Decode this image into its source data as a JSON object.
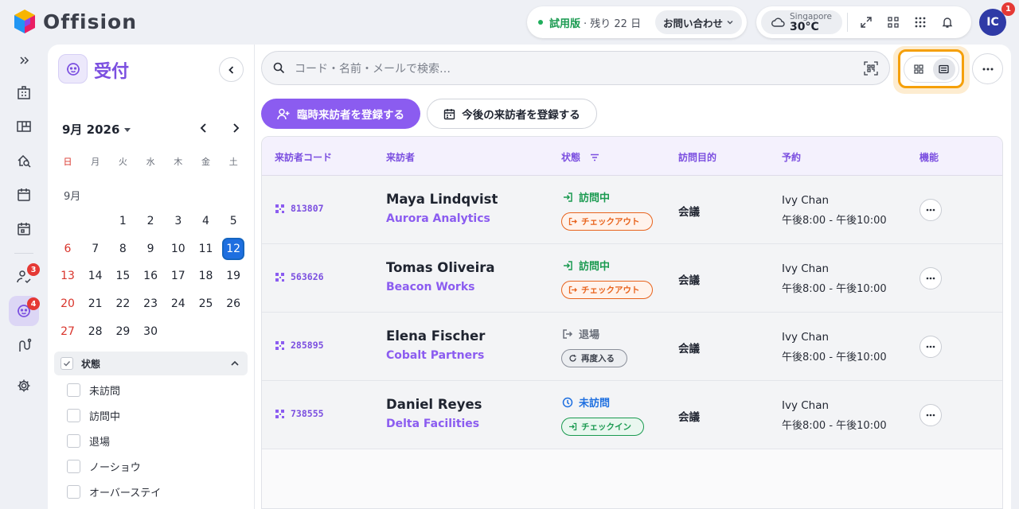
{
  "app": {
    "name": "Offision"
  },
  "trial": {
    "label": "試用版",
    "remaining": "· 残り 22 日",
    "contact": "お問い合わせ"
  },
  "weather": {
    "city": "Singapore",
    "temp": "30°C"
  },
  "user": {
    "initials": "IC",
    "notifications": "1"
  },
  "rail": {
    "visitor_badge": "3",
    "reception_badge": "4"
  },
  "page": {
    "title": "受付"
  },
  "calendar": {
    "month_label": "9月 2026",
    "month_heading": "9月",
    "weekdays": [
      "日",
      "月",
      "火",
      "水",
      "木",
      "金",
      "土"
    ],
    "days": [
      "1",
      "2",
      "3",
      "4",
      "5",
      "6",
      "7",
      "8",
      "9",
      "10",
      "11",
      "12",
      "13",
      "14",
      "15",
      "16",
      "17",
      "18",
      "19",
      "20",
      "21",
      "22",
      "23",
      "24",
      "25",
      "26",
      "27",
      "28",
      "29",
      "30"
    ],
    "selected_day": "12"
  },
  "filter": {
    "title": "状態",
    "options": [
      "未訪問",
      "訪問中",
      "退場",
      "ノーショウ",
      "オーバーステイ"
    ]
  },
  "search": {
    "placeholder": "コード・名前・メールで検索…"
  },
  "actions": {
    "register_adhoc": "臨時来訪者を登録する",
    "register_future": "今後の来訪者を登録する"
  },
  "table": {
    "headers": {
      "code": "来訪者コード",
      "visitor": "来訪者",
      "status": "状態",
      "purpose": "訪問目的",
      "reservation": "予約",
      "functions": "機能"
    },
    "rows": [
      {
        "code": "813807",
        "name": "Maya Lindqvist",
        "company": "Aurora Analytics",
        "status": "訪問中",
        "action": "チェックアウト",
        "purpose": "会議",
        "host": "Ivy Chan",
        "time": "午後8:00 - 午後10:00"
      },
      {
        "code": "563626",
        "name": "Tomas Oliveira",
        "company": "Beacon Works",
        "status": "訪問中",
        "action": "チェックアウト",
        "purpose": "会議",
        "host": "Ivy Chan",
        "time": "午後8:00 - 午後10:00"
      },
      {
        "code": "285895",
        "name": "Elena Fischer",
        "company": "Cobalt Partners",
        "status": "退場",
        "action": "再度入る",
        "purpose": "会議",
        "host": "Ivy Chan",
        "time": "午後8:00 - 午後10:00"
      },
      {
        "code": "738555",
        "name": "Daniel Reyes",
        "company": "Delta Facilities",
        "status": "未訪問",
        "action": "チェックイン",
        "purpose": "会議",
        "host": "Ivy Chan",
        "time": "午後8:00 - 午後10:00"
      }
    ]
  },
  "colors": {
    "accent": "#8b5cf0",
    "checked_in": "#1a9a50",
    "checkout": "#e8631c",
    "not_visited": "#1e6fe0",
    "exited": "#6a6f7a"
  }
}
